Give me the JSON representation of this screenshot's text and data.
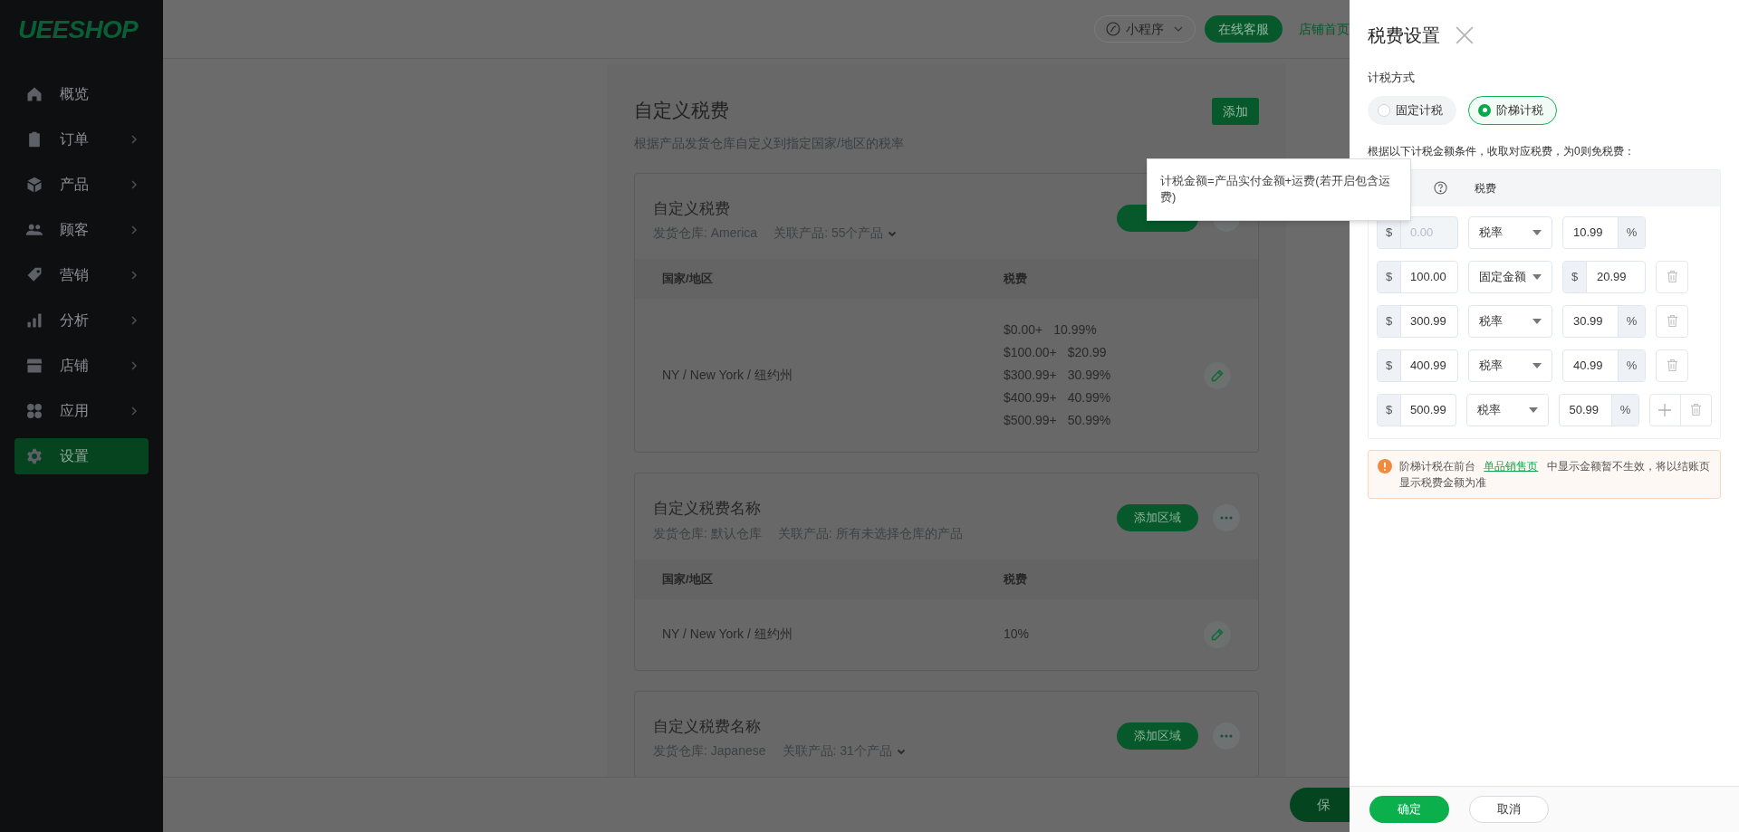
{
  "logo": "UEESHOP",
  "sidebar": {
    "items": [
      {
        "label": "概览",
        "expandable": false,
        "selected": false
      },
      {
        "label": "订单",
        "expandable": true,
        "selected": false
      },
      {
        "label": "产品",
        "expandable": true,
        "selected": false
      },
      {
        "label": "顾客",
        "expandable": true,
        "selected": false
      },
      {
        "label": "营销",
        "expandable": true,
        "selected": false
      },
      {
        "label": "分析",
        "expandable": true,
        "selected": false
      },
      {
        "label": "店铺",
        "expandable": true,
        "selected": false
      },
      {
        "label": "应用",
        "expandable": true,
        "selected": false
      },
      {
        "label": "设置",
        "expandable": false,
        "selected": true
      }
    ]
  },
  "topbar": {
    "mini_program": "小程序",
    "service_button": "在线客服",
    "store_link": "店铺首页"
  },
  "page": {
    "title": "自定义税费",
    "subtitle": "根据产品发货仓库自定义到指定国家/地区的税率",
    "add_button": "添加",
    "cards": [
      {
        "title": "自定义税费",
        "warehouse": "发货仓库: America",
        "products": "关联产品: 55个产品",
        "products_expandable": true,
        "columns": [
          "国家/地区",
          "税费"
        ],
        "rows": [
          {
            "region": "NY / New York / 纽约州",
            "taxes": [
              {
                "threshold": "$0.00+",
                "value": "10.99%"
              },
              {
                "threshold": "$100.00+",
                "value": "$20.99"
              },
              {
                "threshold": "$300.99+",
                "value": "30.99%"
              },
              {
                "threshold": "$400.99+",
                "value": "40.99%"
              },
              {
                "threshold": "$500.99+",
                "value": "50.99%"
              }
            ]
          }
        ]
      },
      {
        "title": "自定义税费名称",
        "warehouse": "发货仓库: 默认仓库",
        "products": "关联产品: 所有未选择仓库的产品",
        "products_expandable": false,
        "add_region_button": "添加区域",
        "columns": [
          "国家/地区",
          "税费"
        ],
        "rows": [
          {
            "region": "NY / New York / 纽约州",
            "taxes": [
              {
                "value": "10%"
              }
            ]
          }
        ]
      },
      {
        "title": "自定义税费名称",
        "warehouse": "发货仓库: Japanese",
        "products": "关联产品: 31个产品",
        "products_expandable": true,
        "add_region_button": "添加区域"
      }
    ]
  },
  "save_button": "保",
  "tooltip": "计税金额=产品实付金额+运费(若开启包含运费)",
  "drawer": {
    "title": "税费设置",
    "method_label": "计税方式",
    "methods": [
      {
        "label": "固定计税",
        "selected": false
      },
      {
        "label": "阶梯计税",
        "selected": true
      }
    ],
    "note": "根据以下计税金额条件，收取对应税费，为0则免税费：",
    "tax_column": "税费",
    "tiers": [
      {
        "currency": "$",
        "amount": "0.00",
        "amount_disabled": true,
        "tax_type": "税率",
        "kind": "percent",
        "unit": "%",
        "value": "10.99",
        "deletable": false,
        "addable": false
      },
      {
        "currency": "$",
        "amount": "100.00",
        "amount_disabled": false,
        "tax_type": "固定金额",
        "kind": "fixed",
        "unit": "$",
        "value": "20.99",
        "deletable": true,
        "addable": false
      },
      {
        "currency": "$",
        "amount": "300.99",
        "amount_disabled": false,
        "tax_type": "税率",
        "kind": "percent",
        "unit": "%",
        "value": "30.99",
        "deletable": true,
        "addable": false
      },
      {
        "currency": "$",
        "amount": "400.99",
        "amount_disabled": false,
        "tax_type": "税率",
        "kind": "percent",
        "unit": "%",
        "value": "40.99",
        "deletable": true,
        "addable": false
      },
      {
        "currency": "$",
        "amount": "500.99",
        "amount_disabled": false,
        "tax_type": "税率",
        "kind": "percent",
        "unit": "%",
        "value": "50.99",
        "deletable": true,
        "addable": true
      }
    ],
    "alert": {
      "before": "阶梯计税在前台",
      "link": "单品销售页",
      "after": "中显示金额暂不生效，将以结账页显示税费金额为准"
    },
    "confirm": "确定",
    "cancel": "取消"
  }
}
